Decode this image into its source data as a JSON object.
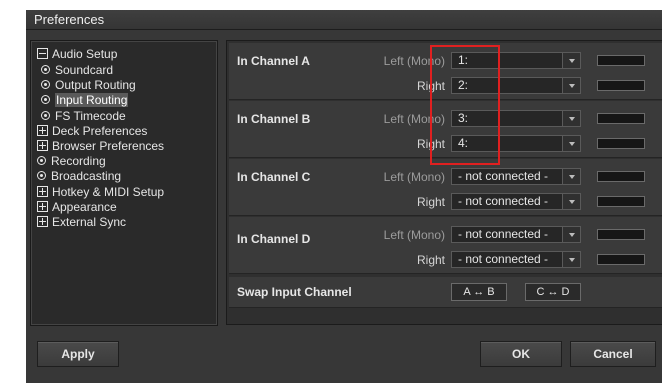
{
  "window": {
    "title": "Preferences"
  },
  "sidebar": {
    "items": [
      {
        "label": "Audio Setup",
        "icon": "collapse-box-icon"
      },
      {
        "label": "Soundcard",
        "icon": "radio-dot-icon"
      },
      {
        "label": "Output Routing",
        "icon": "radio-dot-icon"
      },
      {
        "label": "Input Routing",
        "icon": "radio-dot-icon",
        "selected": true
      },
      {
        "label": "FS Timecode",
        "icon": "radio-dot-icon"
      },
      {
        "label": "Deck Preferences",
        "icon": "expand-box-icon"
      },
      {
        "label": "Browser Preferences",
        "icon": "expand-box-icon"
      },
      {
        "label": "Recording",
        "icon": "radio-dot-icon"
      },
      {
        "label": "Broadcasting",
        "icon": "radio-dot-icon"
      },
      {
        "label": "Hotkey & MIDI Setup",
        "icon": "expand-box-icon"
      },
      {
        "label": "Appearance",
        "icon": "expand-box-icon"
      },
      {
        "label": "External Sync",
        "icon": "expand-box-icon"
      }
    ]
  },
  "routing": {
    "channels": [
      {
        "name": "In Channel A",
        "left_label": "Left (Mono)",
        "left_value": "1:",
        "right_label": "Right",
        "right_value": "2:"
      },
      {
        "name": "In Channel B",
        "left_label": "Left (Mono)",
        "left_value": "3:",
        "right_label": "Right",
        "right_value": "4:"
      },
      {
        "name": "In Channel C",
        "left_label": "Left (Mono)",
        "left_value": "- not connected -",
        "right_label": "Right",
        "right_value": "- not connected -"
      },
      {
        "name": "In Channel D",
        "left_label": "Left (Mono)",
        "left_value": "- not connected -",
        "right_label": "Right",
        "right_value": "- not connected -"
      }
    ],
    "swap": {
      "label": "Swap Input Channel",
      "ab": "A ↔ B",
      "cd": "C ↔ D"
    }
  },
  "footer": {
    "apply": "Apply",
    "ok": "OK",
    "cancel": "Cancel"
  },
  "colors": {
    "highlight": "#e02020",
    "background": "#373737",
    "panel": "#2f2f2f"
  }
}
